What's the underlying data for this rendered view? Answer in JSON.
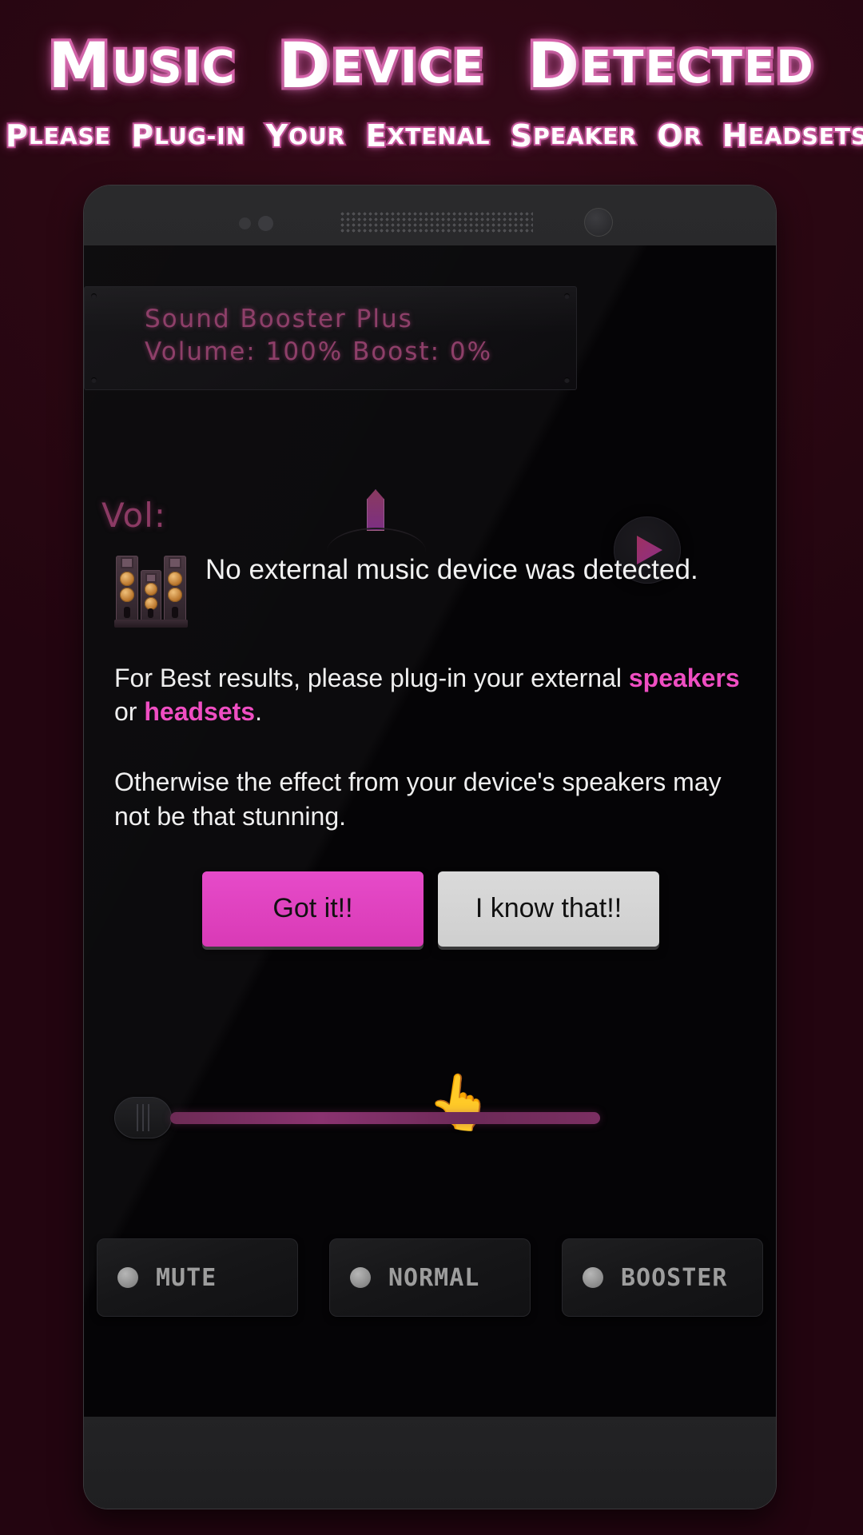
{
  "promo": {
    "title_words": [
      "Music",
      "Device",
      "Detected"
    ],
    "subtitle_words": [
      "Please",
      "Plug-in",
      "Your",
      "Extenal",
      "Speaker",
      "Or",
      "Headsets"
    ],
    "title_color": "#ffffff",
    "title_outline_color": "#d763ab",
    "background_color": "#2b0713"
  },
  "phone": {
    "display": {
      "app_name": "Sound Booster Plus",
      "status_line": "Volume: 100%   Boost: 0%",
      "volume_percent": "100%",
      "boost_percent": "0%",
      "text_color": "#8e3f69"
    },
    "play_button_icon": "play-icon",
    "volume_label": "Vol:",
    "slider": {
      "name": "volume-slider",
      "fill_color": "#8a3370"
    },
    "modes": [
      {
        "label": "MUTE",
        "icon": "led-indicator"
      },
      {
        "label": "NORMAL",
        "icon": "led-indicator"
      },
      {
        "label": "BOOSTER",
        "icon": "led-indicator"
      }
    ]
  },
  "dialog": {
    "icon": "speaker-towers-icon",
    "heading": "No external music device was detected.",
    "paragraph1_pre": "For Best results, please plug-in your external ",
    "paragraph1_hl1": "speakers",
    "paragraph1_mid": " or ",
    "paragraph1_hl2": "headsets",
    "paragraph1_post": ".",
    "paragraph2": "Otherwise the effect from your device's speakers may not be that stunning.",
    "primary_button": "Got it!!",
    "secondary_button": "I know that!!",
    "primary_color": "#e248c4",
    "secondary_color": "#d4d4d4",
    "highlight_color": "#ef4ec2",
    "cursor_icon": "pointing-hand-cursor"
  }
}
